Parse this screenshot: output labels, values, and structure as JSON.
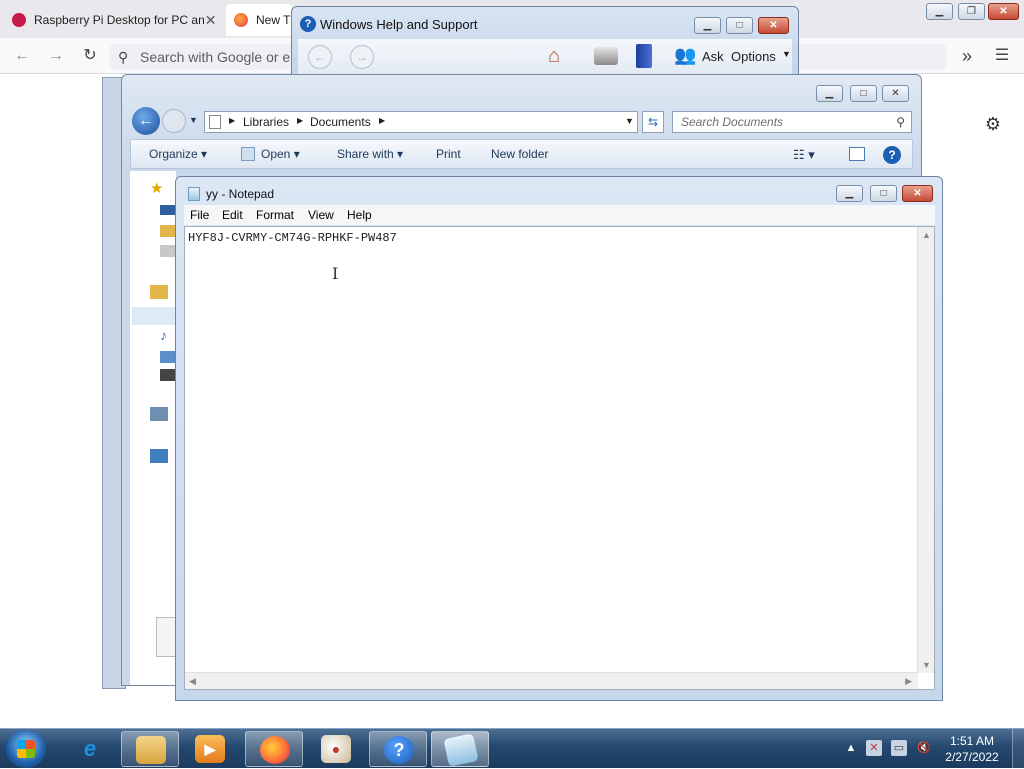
{
  "firefox": {
    "tabs": [
      {
        "label": "Raspberry Pi Desktop for PC an"
      },
      {
        "label": "New T"
      }
    ],
    "search_placeholder": "Search with Google or er"
  },
  "help_window": {
    "title": "Windows Help and Support",
    "ask_label": "Ask",
    "options_label": "Options"
  },
  "explorer": {
    "breadcrumb": [
      "Libraries",
      "Documents"
    ],
    "search_placeholder": "Search Documents",
    "commands": [
      "Organize",
      "Open",
      "Share with",
      "Print",
      "New folder"
    ]
  },
  "notepad": {
    "title": "yy - Notepad",
    "menu": [
      "File",
      "Edit",
      "Format",
      "View",
      "Help"
    ],
    "content": "HYF8J-CVRMY-CM74G-RPHKF-PW487"
  },
  "taskbar": {
    "time": "1:51 AM",
    "date": "2/27/2022"
  },
  "colors": {
    "taskbar": "#24486e",
    "close_button": "#c74a34",
    "help_button": "#1a5fb4",
    "firefox_accent": "#ff7139"
  }
}
